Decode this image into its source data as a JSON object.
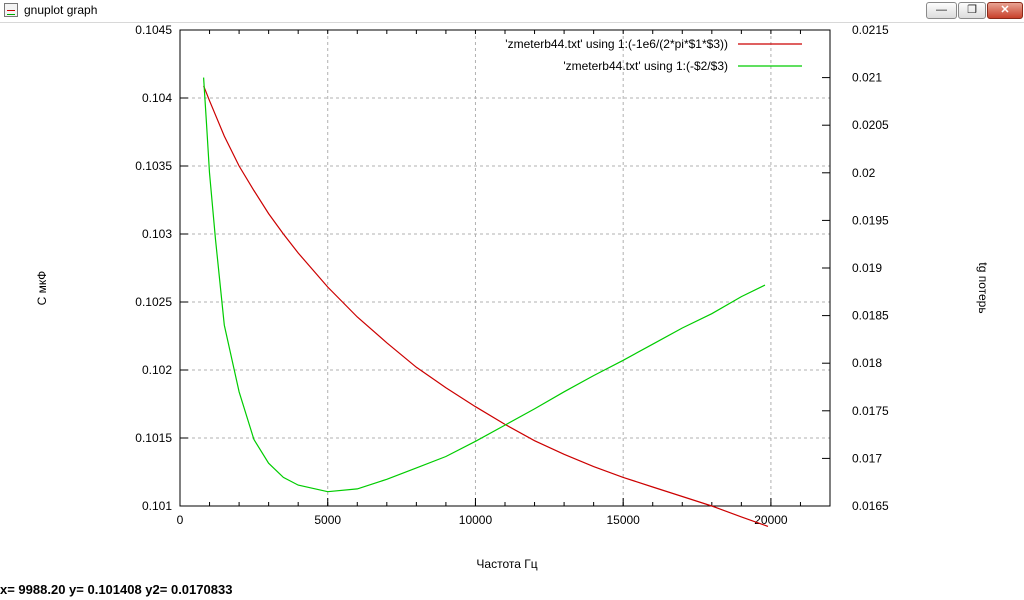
{
  "window": {
    "title": "gnuplot graph",
    "minimize_label": "—",
    "maximize_label": "❐",
    "close_label": "✕"
  },
  "status_bar": {
    "text": "x= 9988.20 y= 0.101408 y2= 0.0170833"
  },
  "chart_data": {
    "type": "line",
    "xlabel": "Частота Гц",
    "ylabel": "С мкФ",
    "y2label": "tg потерь",
    "xlim": [
      0,
      22000
    ],
    "ylim": [
      0.101,
      0.1045
    ],
    "y2lim": [
      0.0165,
      0.0215
    ],
    "xticks": [
      0,
      5000,
      10000,
      15000,
      20000
    ],
    "xtick_labels": [
      "0",
      "5000",
      "10000",
      "15000",
      "20000"
    ],
    "yticks": [
      0.101,
      0.1015,
      0.102,
      0.1025,
      0.103,
      0.1035,
      0.104,
      0.1045
    ],
    "ytick_labels": [
      "0.101",
      "0.1015",
      "0.102",
      "0.1025",
      "0.103",
      "0.1035",
      "0.104",
      "0.1045"
    ],
    "y2ticks": [
      0.0165,
      0.017,
      0.0175,
      0.018,
      0.0185,
      0.019,
      0.0195,
      0.02,
      0.0205,
      0.021,
      0.0215
    ],
    "y2tick_labels": [
      "0.0165",
      "0.017",
      "0.0175",
      "0.018",
      "0.0185",
      "0.019",
      "0.0195",
      "0.02",
      "0.0205",
      "0.021",
      "0.0215"
    ],
    "grid": true,
    "legend_position": "top-right",
    "series": [
      {
        "name": "'zmeterb44.txt' using 1:(-1e6/(2*pi*$1*$3))",
        "axis": "y",
        "color": "#cc0000",
        "x": [
          800,
          1000,
          1500,
          2000,
          2500,
          3000,
          3500,
          4000,
          5000,
          6000,
          7000,
          8000,
          9000,
          10000,
          11000,
          12000,
          13000,
          14000,
          15000,
          16000,
          17000,
          18000,
          19000,
          19900
        ],
        "y": [
          0.10409,
          0.10398,
          0.10372,
          0.1035,
          0.10332,
          0.10315,
          0.103,
          0.10286,
          0.10261,
          0.10239,
          0.1022,
          0.10202,
          0.10187,
          0.10173,
          0.1016,
          0.10148,
          0.10138,
          0.10129,
          0.10121,
          0.10114,
          0.10107,
          0.101,
          0.10092,
          0.10085
        ]
      },
      {
        "name": "'zmeterb44.txt' using 1:(-$2/$3)",
        "axis": "y2",
        "color": "#00cc00",
        "x": [
          800,
          900,
          1000,
          1200,
          1500,
          2000,
          2500,
          3000,
          3500,
          4000,
          5000,
          6000,
          7000,
          8000,
          9000,
          10000,
          11000,
          12000,
          13000,
          14000,
          15000,
          16000,
          17000,
          18000,
          19000,
          19800
        ],
        "y": [
          0.021,
          0.0205,
          0.02,
          0.0193,
          0.0184,
          0.0177,
          0.0172,
          0.01695,
          0.0168,
          0.01672,
          0.01665,
          0.01668,
          0.01678,
          0.0169,
          0.01702,
          0.01718,
          0.01735,
          0.01752,
          0.0177,
          0.01787,
          0.01803,
          0.0182,
          0.01837,
          0.01852,
          0.0187,
          0.01882
        ]
      }
    ]
  }
}
